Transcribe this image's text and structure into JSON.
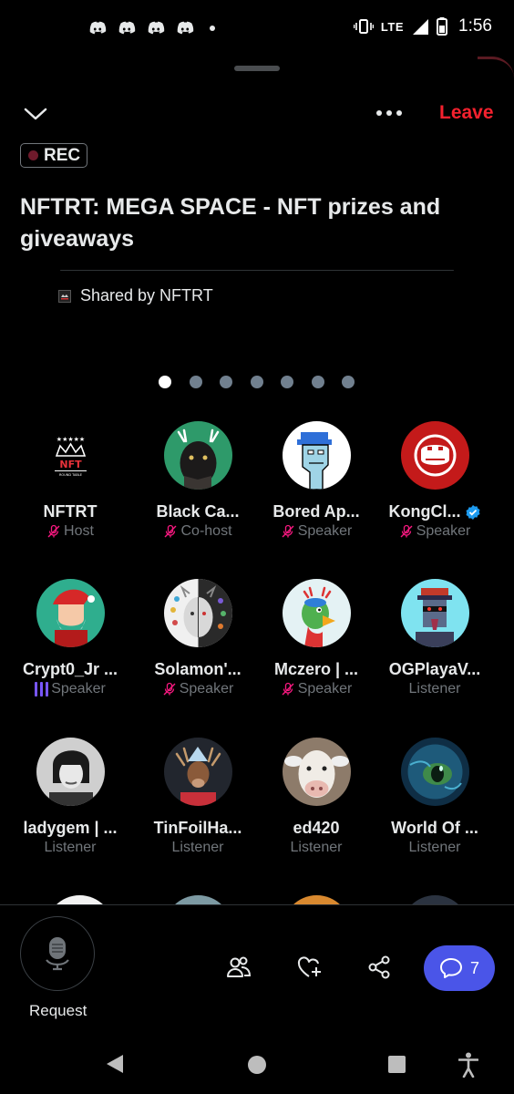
{
  "status_bar": {
    "network": "LTE",
    "time": "1:56",
    "notification_icons": [
      "discord-icon",
      "discord-icon",
      "discord-icon",
      "discord-icon"
    ]
  },
  "header": {
    "leave_label": "Leave",
    "rec_label": "REC",
    "title": "NFTRT: MEGA SPACE - NFT prizes and giveaways",
    "shared_by": "Shared by NFTRT",
    "page_count": 7,
    "active_page": 1
  },
  "participants": [
    {
      "name": "NFTRT",
      "role": "Host",
      "mic": "muted",
      "avatar_color": "#000000"
    },
    {
      "name": "Black Ca...",
      "role": "Co-host",
      "mic": "muted",
      "avatar_color": "#2e9a6a"
    },
    {
      "name": "Bored Ap...",
      "role": "Speaker",
      "mic": "muted",
      "avatar_color": "#ffffff"
    },
    {
      "name": "KongCl...",
      "role": "Speaker",
      "mic": "muted",
      "verified": true,
      "avatar_color": "#c41a1a"
    },
    {
      "name": "Crypt0_Jr ...",
      "role": "Speaker",
      "mic": "speaking",
      "avatar_color": "#2fae8e"
    },
    {
      "name": "Solamon'...",
      "role": "Speaker",
      "mic": "muted",
      "avatar_color": "#e8e8e8"
    },
    {
      "name": "Mczero | ...",
      "role": "Speaker",
      "mic": "muted",
      "avatar_color": "#d8eef0"
    },
    {
      "name": "OGPlayaV...",
      "role": "Listener",
      "mic": "none",
      "avatar_color": "#7fe3f0"
    },
    {
      "name": "ladygem | ...",
      "role": "Listener",
      "mic": "none",
      "avatar_color": "#9a9a9a"
    },
    {
      "name": "TinFoilHa...",
      "role": "Listener",
      "mic": "none",
      "avatar_color": "#2a2f3a"
    },
    {
      "name": "ed420",
      "role": "Listener",
      "mic": "none",
      "avatar_color": "#8d7b6a"
    },
    {
      "name": "World Of ...",
      "role": "Listener",
      "mic": "none",
      "avatar_color": "#1a4a6a"
    }
  ],
  "bottom_bar": {
    "request_label": "Request",
    "comments_count": "7"
  },
  "colors": {
    "leave": "#f4212e",
    "accent": "#4a55e8",
    "speaking": "#7856ff",
    "muted": "#f91880",
    "verified": "#1d9bf0"
  }
}
